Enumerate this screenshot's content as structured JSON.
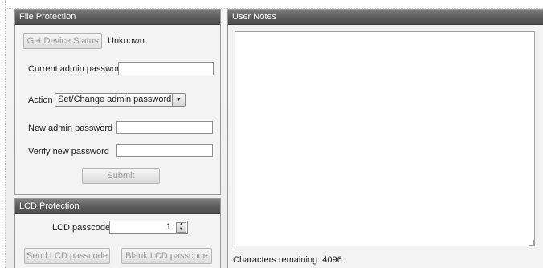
{
  "file_protection": {
    "title": "File Protection",
    "get_status_button": "Get Device Status",
    "status_value": "Unknown",
    "current_password_label": "Current admin password",
    "current_password_value": "",
    "action_label": "Action",
    "action_selected": "Set/Change admin password",
    "new_password_label": "New admin password",
    "new_password_value": "",
    "verify_password_label": "Verify new password",
    "verify_password_value": "",
    "submit_button": "Submit"
  },
  "lcd_protection": {
    "title": "LCD Protection",
    "passcode_label": "LCD passcode",
    "passcode_value": "1",
    "send_button": "Send LCD passcode",
    "blank_button": "Blank LCD passcode"
  },
  "user_notes": {
    "title": "User Notes",
    "notes_value": "",
    "chars_remaining_label": "Characters remaining:",
    "chars_remaining_value": "4096"
  },
  "icons": {
    "dropdown": "chevron-down-icon",
    "spinner": "spinner-arrows-icon"
  },
  "colors": {
    "header_bg": "#5b5b5b",
    "panel_bg": "#f3f3f3",
    "disabled_text": "#9a9a9a"
  }
}
